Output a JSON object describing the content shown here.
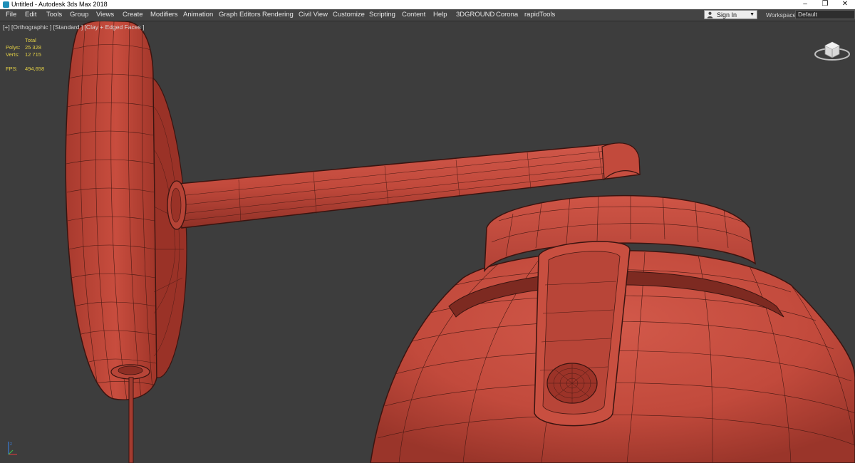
{
  "window": {
    "title": "Untitled - Autodesk 3ds Max 2018",
    "controls": [
      "–",
      "❐",
      "✕"
    ]
  },
  "menu": {
    "items": [
      {
        "label": "File",
        "name": "menu-file"
      },
      {
        "label": "Edit",
        "name": "menu-edit"
      },
      {
        "label": "Tools",
        "name": "menu-tools"
      },
      {
        "label": "Group",
        "name": "menu-group"
      },
      {
        "label": "Views",
        "name": "menu-views"
      },
      {
        "label": "Create",
        "name": "menu-create"
      },
      {
        "label": "Modifiers",
        "name": "menu-modifiers"
      },
      {
        "label": "Animation",
        "name": "menu-animation"
      },
      {
        "label": "Graph Editors",
        "name": "menu-graph-editors"
      },
      {
        "label": "Rendering",
        "name": "menu-rendering"
      },
      {
        "label": "Civil View",
        "name": "menu-civil-view"
      },
      {
        "label": "Customize",
        "name": "menu-customize"
      },
      {
        "label": "Scripting",
        "name": "menu-scripting"
      },
      {
        "label": "Content",
        "name": "menu-content"
      },
      {
        "label": "Help",
        "name": "menu-help"
      },
      {
        "label": "3DGROUND",
        "name": "menu-3dground"
      },
      {
        "label": "Corona",
        "name": "menu-corona"
      },
      {
        "label": "rapidTools",
        "name": "menu-rapidtools"
      }
    ],
    "sign_in": "Sign In",
    "workspaces_label": "Workspaces:",
    "workspace_value": "Default"
  },
  "viewport": {
    "label": "[+] [Orthographic ] [Standard ] [Clay + Edged Faces ]",
    "stats": {
      "header": "Total",
      "polys_label": "Polys:",
      "polys_value": "25 328",
      "verts_label": "Verts:",
      "verts_value": "12 715",
      "fps_label": "FPS:",
      "fps_value": "494,658"
    }
  },
  "colors": {
    "clay": "#c24a3c",
    "clay_dark": "#7a2a22",
    "wire": "#3a1410",
    "viewport_bg": "#3d3d3d",
    "menubar_bg": "#444444",
    "stats_yellow": "#e3d046"
  },
  "icons": {
    "app": "3dsmax-app-icon",
    "user": "user-icon",
    "dropdown": "chevron-down-icon",
    "viewcube": "viewcube-icon",
    "axis": "axis-tripod-icon"
  }
}
